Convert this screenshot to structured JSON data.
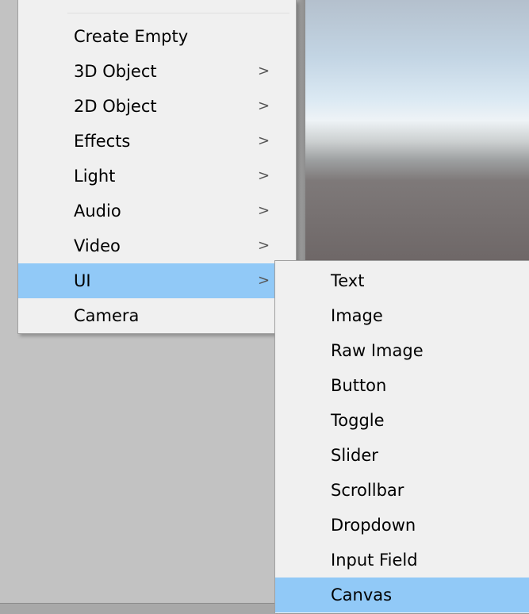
{
  "main_menu": {
    "items": [
      {
        "label": "Create Empty",
        "has_submenu": false,
        "highlighted": false
      },
      {
        "label": "3D Object",
        "has_submenu": true,
        "highlighted": false
      },
      {
        "label": "2D Object",
        "has_submenu": true,
        "highlighted": false
      },
      {
        "label": "Effects",
        "has_submenu": true,
        "highlighted": false
      },
      {
        "label": "Light",
        "has_submenu": true,
        "highlighted": false
      },
      {
        "label": "Audio",
        "has_submenu": true,
        "highlighted": false
      },
      {
        "label": "Video",
        "has_submenu": true,
        "highlighted": false
      },
      {
        "label": "UI",
        "has_submenu": true,
        "highlighted": true
      },
      {
        "label": "Camera",
        "has_submenu": false,
        "highlighted": false
      }
    ],
    "submenu_arrow": ">"
  },
  "ui_submenu": {
    "items": [
      {
        "label": "Text",
        "highlighted": false
      },
      {
        "label": "Image",
        "highlighted": false
      },
      {
        "label": "Raw Image",
        "highlighted": false
      },
      {
        "label": "Button",
        "highlighted": false
      },
      {
        "label": "Toggle",
        "highlighted": false
      },
      {
        "label": "Slider",
        "highlighted": false
      },
      {
        "label": "Scrollbar",
        "highlighted": false
      },
      {
        "label": "Dropdown",
        "highlighted": false
      },
      {
        "label": "Input Field",
        "highlighted": false
      },
      {
        "label": "Canvas",
        "highlighted": true
      }
    ]
  },
  "colors": {
    "menu_background": "#f0f0f0",
    "highlight": "#91c9f7",
    "panel_background": "#c2c2c2"
  }
}
